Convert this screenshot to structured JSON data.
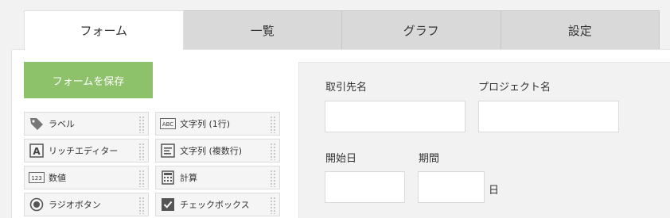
{
  "tabs": [
    {
      "label": "フォーム",
      "active": true
    },
    {
      "label": "一覧",
      "active": false
    },
    {
      "label": "グラフ",
      "active": false
    },
    {
      "label": "設定",
      "active": false
    }
  ],
  "save_button": {
    "label": "フォームを保存"
  },
  "palette": [
    {
      "label": "ラベル",
      "icon": "tag-icon"
    },
    {
      "label": "文字列 (1行)",
      "icon": "abc-text-icon"
    },
    {
      "label": "リッチエディター",
      "icon": "rich-editor-icon"
    },
    {
      "label": "文字列 (複数行)",
      "icon": "multiline-text-icon"
    },
    {
      "label": "数値",
      "icon": "number-icon"
    },
    {
      "label": "計算",
      "icon": "calculator-icon"
    },
    {
      "label": "ラジオボタン",
      "icon": "radio-icon"
    },
    {
      "label": "チェックボックス",
      "icon": "checkbox-icon"
    }
  ],
  "form_fields": [
    {
      "label": "取引先名",
      "value": ""
    },
    {
      "label": "プロジェクト名",
      "value": ""
    },
    {
      "label": "開始日",
      "value": ""
    },
    {
      "label": "期間",
      "value": "",
      "unit": "日"
    }
  ],
  "colors": {
    "accent": "#8dc16a",
    "tab_inactive": "#d9d9d9",
    "canvas": "#f2f2f2"
  }
}
